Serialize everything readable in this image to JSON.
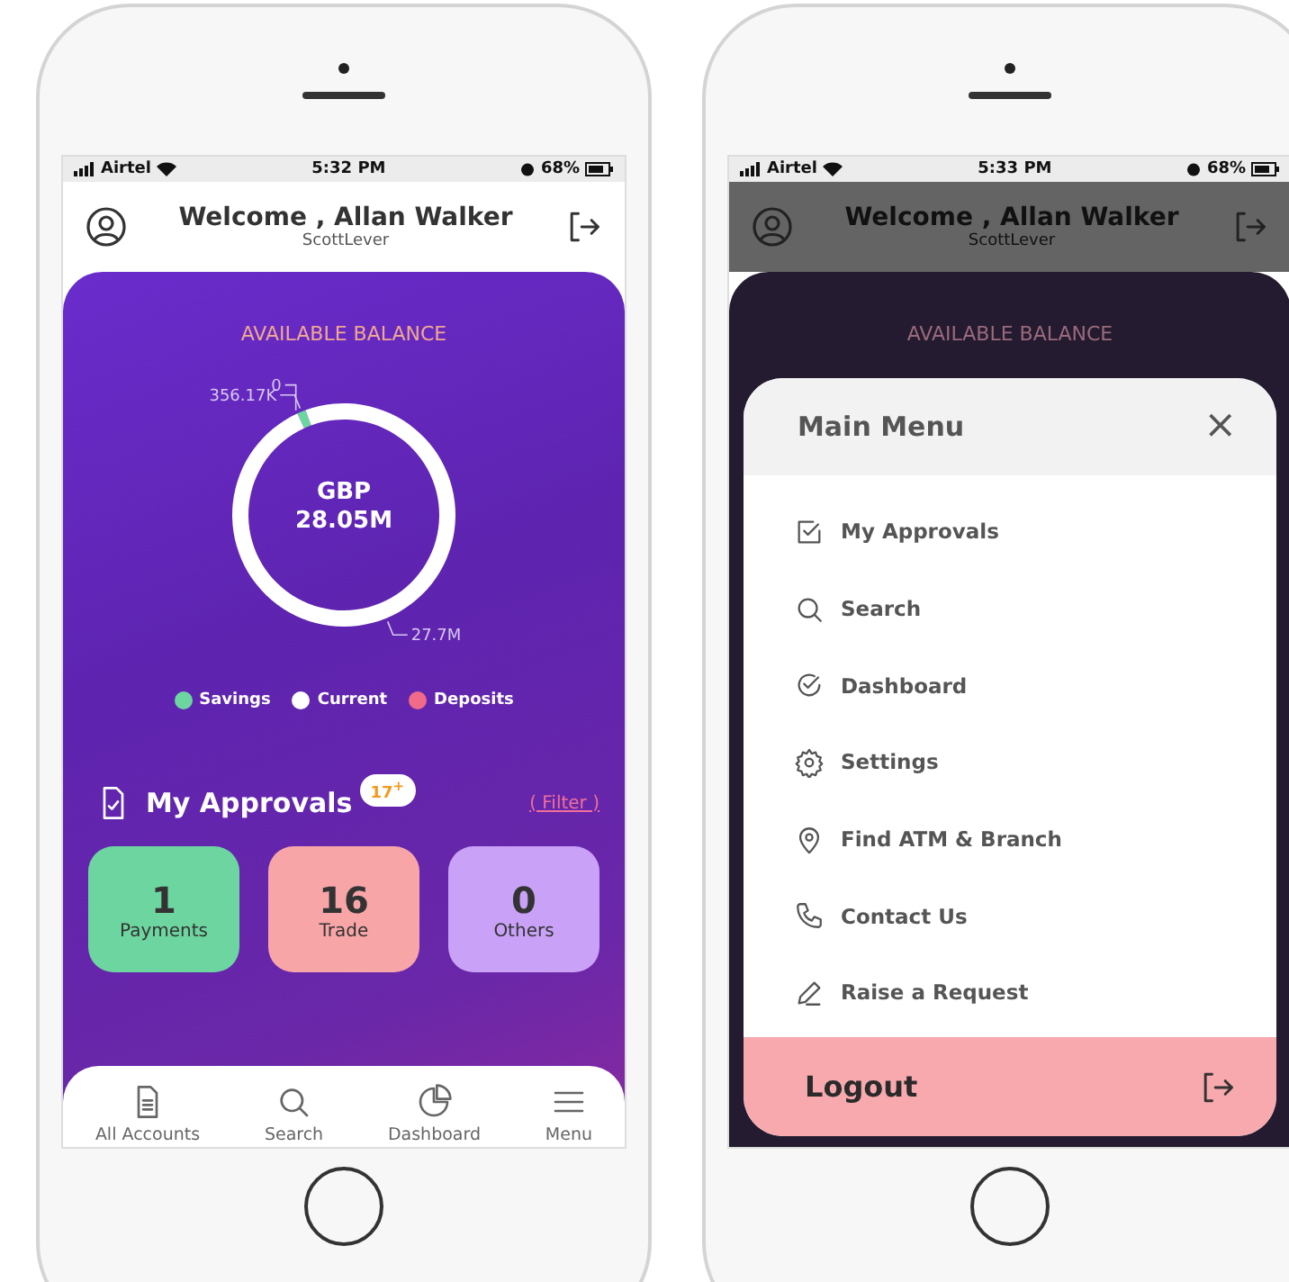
{
  "dashboard_screen": {
    "status_bar": {
      "carrier": "Airtel",
      "time": "5:32 PM",
      "battery": "68%"
    },
    "header": {
      "title": "Welcome , Allan Walker",
      "subtitle": "ScottLever"
    },
    "balance_card": {
      "title": "AVAILABLE BALANCE",
      "center_currency": "GBP",
      "center_amount": "28.05M",
      "chart_data": {
        "type": "donut",
        "categories": [
          "Savings",
          "Current",
          "Deposits"
        ],
        "values": [
          356170,
          27700000,
          0
        ],
        "colors": [
          "#6dd6a0",
          "#ffffff",
          "#f06a8a"
        ],
        "value_labels": [
          "356.17K",
          "27.7M",
          "0"
        ]
      }
    },
    "approvals": {
      "title": "My Approvals",
      "badge": "17$^{+}$",
      "filter_link": "( Filter )",
      "tiles": [
        {
          "count": "1",
          "label": "Payments",
          "color": "#6dd6a0"
        },
        {
          "count": "16",
          "label": "Trade",
          "color": "#f8a5a8"
        },
        {
          "count": "0",
          "label": "Others",
          "color": "#c9a2f8"
        }
      ]
    },
    "bottom_nav": [
      {
        "label": "All Accounts"
      },
      {
        "label": "Search"
      },
      {
        "label": "Dashboard"
      },
      {
        "label": "Menu"
      }
    ]
  },
  "menu_screen": {
    "status_bar": {
      "carrier": "Airtel",
      "time": "5:33 PM",
      "battery": "68%"
    },
    "header": {
      "title": "Welcome , Allan Walker",
      "subtitle": "ScottLever"
    },
    "balance_title": "AVAILABLE BALANCE",
    "menu": {
      "title": "Main Menu",
      "close": "×",
      "items": [
        {
          "label": "My Approvals"
        },
        {
          "label": "Search"
        },
        {
          "label": "Dashboard"
        },
        {
          "label": "Settings"
        },
        {
          "label": "Find ATM & Branch"
        },
        {
          "label": "Contact Us"
        },
        {
          "label": "Raise a Request"
        }
      ],
      "logout": "Logout"
    }
  }
}
